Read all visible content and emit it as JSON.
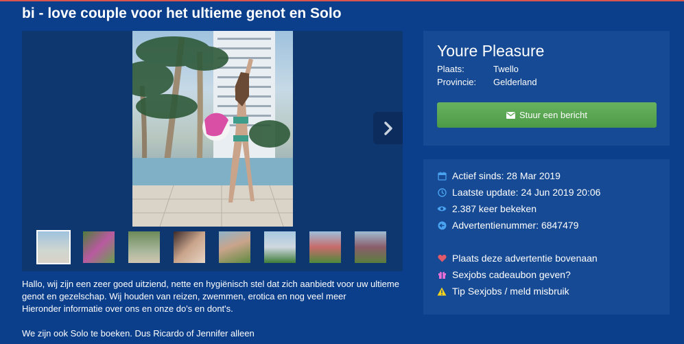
{
  "page": {
    "title": "bi - love couple voor het ultieme genot en Solo"
  },
  "profile": {
    "name": "Youre Pleasure",
    "place_label": "Plaats:",
    "place_value": "Twello",
    "province_label": "Provincie:",
    "province_value": "Gelderland",
    "message_button": "Stuur een bericht"
  },
  "info": {
    "active": "Actief sinds: 28 Mar 2019",
    "updated": "Laatste update: 24 Jun 2019 20:06",
    "views": "2.387 keer bekeken",
    "ad_number": "Advertentienummer: 6847479"
  },
  "actions": {
    "promote": "Plaats deze advertentie bovenaan",
    "gift": "Sexjobs cadeaubon geven?",
    "report": "Tip Sexjobs / meld misbruik"
  },
  "description": {
    "line1": "Hallo, wij zijn een zeer goed uitziend, nette en hygiënisch stel dat zich aanbiedt voor uw ultieme",
    "line2": "genot en gezelschap. Wij houden van reizen, zwemmen, erotica en nog veel meer",
    "line3": "Hieronder informatie over ons en onze do's en dont's.",
    "line4": "We zijn ook Solo te boeken. Dus Ricardo of Jennifer alleen"
  },
  "colors": {
    "background": "#0b3f8c",
    "panel": "#164a94",
    "button_green": "#5aa651",
    "icon_blue": "#4aa3f0",
    "heart_red": "#e05a6a",
    "gift_pink": "#e76fd6",
    "warning_yellow": "#f2d21c"
  },
  "icons": {
    "next": "chevron-right-icon",
    "message": "envelope-icon",
    "active": "calendar-icon",
    "updated": "clock-icon",
    "views": "eye-icon",
    "ad_number": "arrow-circle-icon",
    "promote": "heart-icon",
    "gift": "gift-icon",
    "report": "warning-icon"
  },
  "gallery": {
    "thumb_count": 8,
    "active_thumb": 1
  }
}
